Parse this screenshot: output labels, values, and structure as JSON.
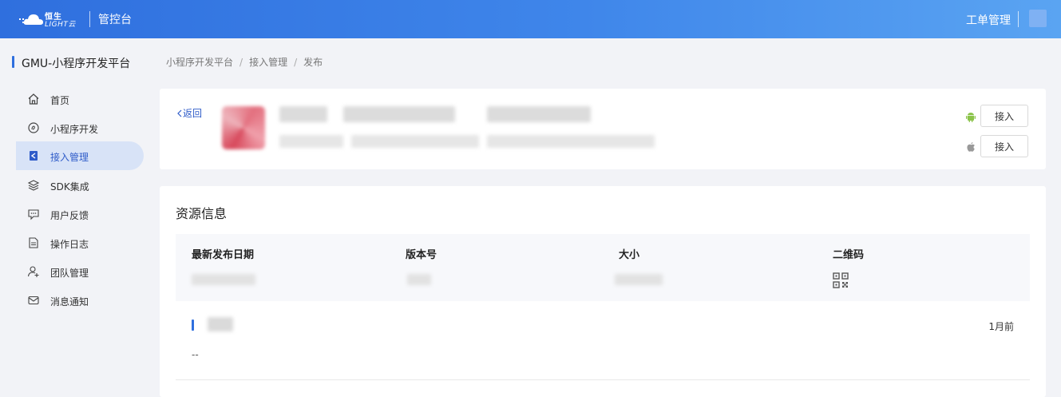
{
  "topbar": {
    "logo_line1": "恒生",
    "logo_line2": "LIGHT云",
    "console_title": "管控台",
    "ticket_link": "工单管理"
  },
  "sidebar": {
    "platform_name": "GMU-小程序开发平台",
    "items": [
      {
        "label": "首页",
        "icon": "home-icon"
      },
      {
        "label": "小程序开发",
        "icon": "dev-icon"
      },
      {
        "label": "接入管理",
        "icon": "access-icon",
        "active": true
      },
      {
        "label": "SDK集成",
        "icon": "layers-icon"
      },
      {
        "label": "用户反馈",
        "icon": "feedback-icon"
      },
      {
        "label": "操作日志",
        "icon": "log-icon"
      },
      {
        "label": "团队管理",
        "icon": "team-icon"
      },
      {
        "label": "消息通知",
        "icon": "mail-icon"
      }
    ]
  },
  "breadcrumb": [
    "小程序开发平台",
    "接入管理",
    "发布"
  ],
  "app_card": {
    "back_label": "返回",
    "android_button": "接入",
    "ios_button": "接入"
  },
  "resource": {
    "title": "资源信息",
    "headers": [
      "最新发布日期",
      "版本号",
      "大小",
      "二维码"
    ],
    "version_time": "1月前",
    "version_desc": "--"
  },
  "colors": {
    "primary": "#2f6fde",
    "active_bg": "#d8e3f7",
    "android": "#8bc34a",
    "apple": "#999999"
  }
}
